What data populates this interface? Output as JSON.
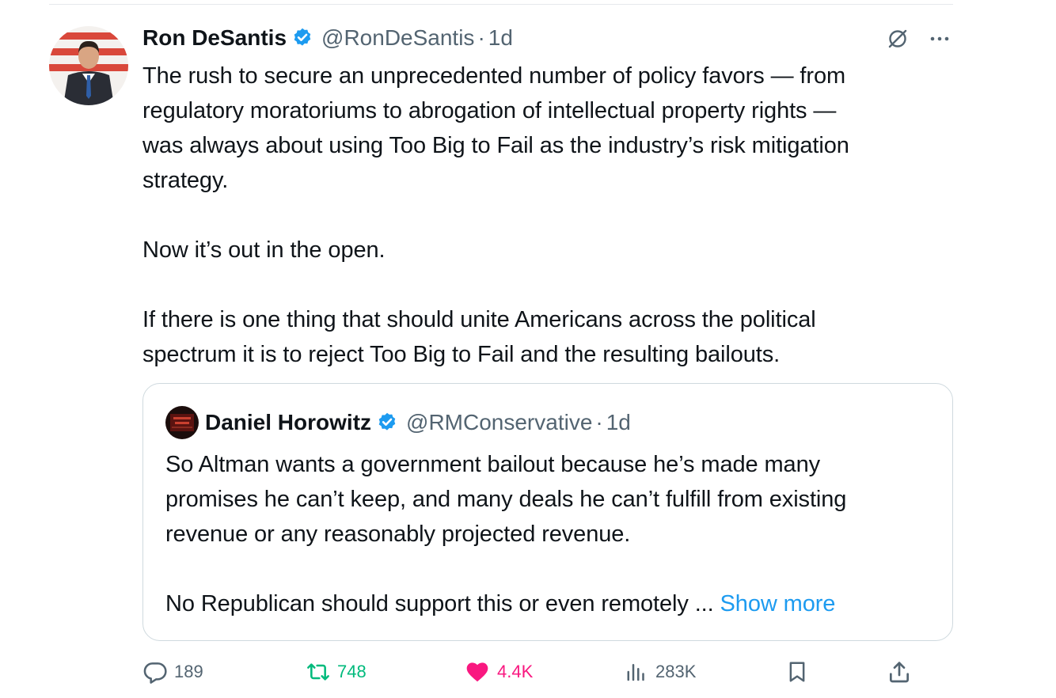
{
  "tweet": {
    "author_name": "Ron DeSantis",
    "author_handle": "@RonDeSantis",
    "separator": "·",
    "time": "1d",
    "text": "The rush to secure an unprecedented number of policy favors — from\nregulatory moratoriums to abrogation of intellectual property rights —\nwas always about using Too Big to Fail as the industry’s risk mitigation\nstrategy.\n\nNow it’s out in the open.\n\nIf there is one thing that should unite Americans across the political\nspectrum it is to reject Too Big to Fail and the resulting bailouts."
  },
  "quote": {
    "author_name": "Daniel Horowitz",
    "author_handle": "@RMConservative",
    "separator": "·",
    "time": "1d",
    "text": "So Altman wants a government bailout because he’s made many\npromises he can’t keep, and many deals he can’t fulfill from existing\nrevenue or any reasonably projected revenue.\n\nNo Republican should support this or even remotely ... ",
    "show_more": "Show more"
  },
  "actions": {
    "replies": "189",
    "reposts": "748",
    "likes": "4.4K",
    "views": "283K"
  },
  "icons": {
    "verified": "verified-badge-icon",
    "grok": "grok-icon",
    "more": "more-icon",
    "reply": "reply-icon",
    "repost": "repost-icon",
    "like": "heart-icon",
    "views": "views-icon",
    "bookmark": "bookmark-icon",
    "share": "share-icon"
  },
  "colors": {
    "accent": "#1d9bf0",
    "repost": "#00ba7c",
    "like": "#f91880",
    "muted": "#536471",
    "text": "#0f1419",
    "border": "#cfd9de"
  }
}
